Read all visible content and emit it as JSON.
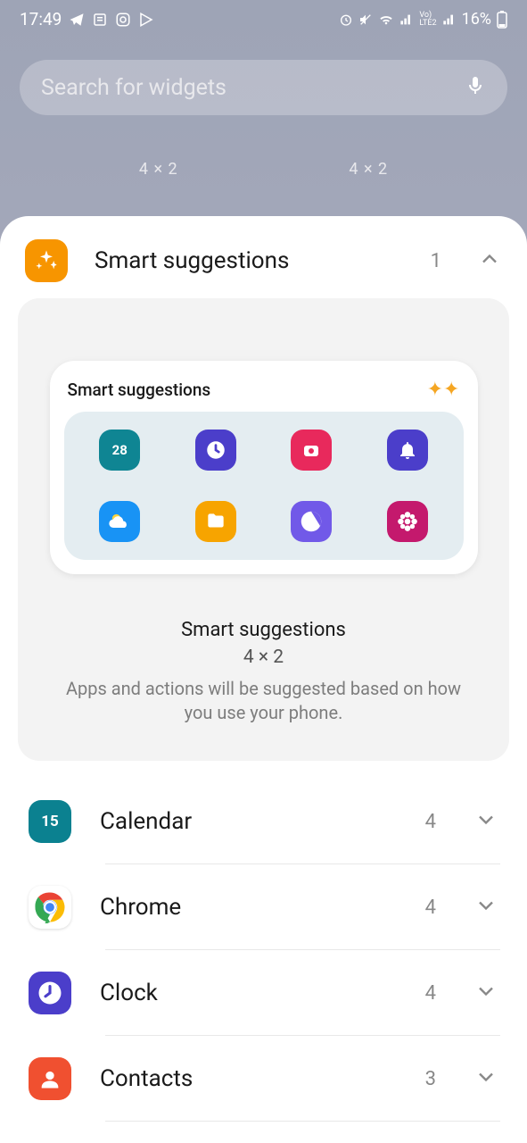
{
  "status": {
    "time": "17:49",
    "battery": "16%"
  },
  "search": {
    "placeholder": "Search for widgets"
  },
  "tabs": [
    "4 × 2",
    "4 × 2"
  ],
  "expanded": {
    "title": "Smart suggestions",
    "count": "1",
    "widget_label": "Smart suggestions",
    "preview_title": "Smart suggestions",
    "preview_size": "4 × 2",
    "preview_desc": "Apps and actions will be suggested based on how you use your phone."
  },
  "apps": [
    {
      "name": "Calendar",
      "count": "4",
      "day": "15"
    },
    {
      "name": "Chrome",
      "count": "4"
    },
    {
      "name": "Clock",
      "count": "4"
    },
    {
      "name": "Contacts",
      "count": "3"
    }
  ],
  "grid_day": "28"
}
